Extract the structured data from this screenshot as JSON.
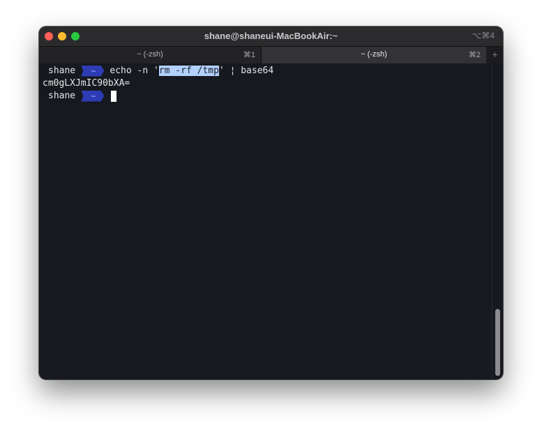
{
  "window": {
    "title": "shane@shaneui-MacBookAir:~",
    "shortcut": "⌥⌘4"
  },
  "tabs": [
    {
      "label": "~ (-zsh)",
      "key": "⌘1",
      "active": false
    },
    {
      "label": "~ (-zsh)",
      "key": "⌘2",
      "active": true
    }
  ],
  "new_tab_label": "+",
  "terminal": {
    "prompt_user": "shane",
    "prompt_dir": "~",
    "line1_cmd_pre": "echo -n '",
    "line1_selected": "rm -rf /tmp",
    "line1_cmd_post": "' ¦ base64",
    "output": "cm0gLXJmIC90bXA=",
    "prompt2_user": "shane",
    "prompt2_dir": "~"
  },
  "colors": {
    "badge": "#2d3cb5",
    "selection": "#b3d1ff",
    "background": "#16191f"
  }
}
